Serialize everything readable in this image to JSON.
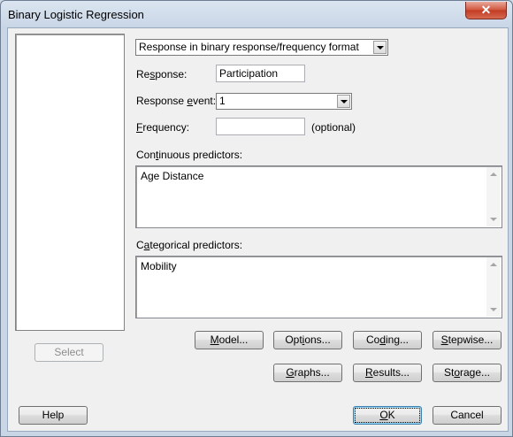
{
  "window": {
    "title": "Binary Logistic Regression",
    "close_glyph": "✕"
  },
  "format_combo": {
    "value": "Response in binary response/frequency format"
  },
  "response": {
    "label_pre": "Re",
    "label_u": "s",
    "label_post": "ponse:",
    "value": "Participation"
  },
  "response_event": {
    "label_pre": "Response ",
    "label_u": "e",
    "label_post": "vent:",
    "value": "1"
  },
  "frequency": {
    "label_u": "F",
    "label_post": "requency:",
    "value": "",
    "note": "(optional)"
  },
  "continuous": {
    "label_pre": "Con",
    "label_u": "t",
    "label_post": "inuous predictors:",
    "value": "Age Distance"
  },
  "categorical": {
    "label_pre": "C",
    "label_u": "a",
    "label_post": "tegorical predictors:",
    "value": "Mobility"
  },
  "buttons": {
    "select": "Select",
    "model_u": "M",
    "model_post": "odel...",
    "options_pre": "Opt",
    "options_u": "i",
    "options_post": "ons...",
    "coding_pre": "Co",
    "coding_u": "d",
    "coding_post": "ing...",
    "stepwise_u": "S",
    "stepwise_post": "tepwise...",
    "graphs_u": "G",
    "graphs_post": "raphs...",
    "results_u": "R",
    "results_post": "esults...",
    "storage_pre": "St",
    "storage_u": "o",
    "storage_post": "rage...",
    "help": "Help",
    "ok_u": "O",
    "ok_post": "K",
    "cancel": "Cancel"
  }
}
